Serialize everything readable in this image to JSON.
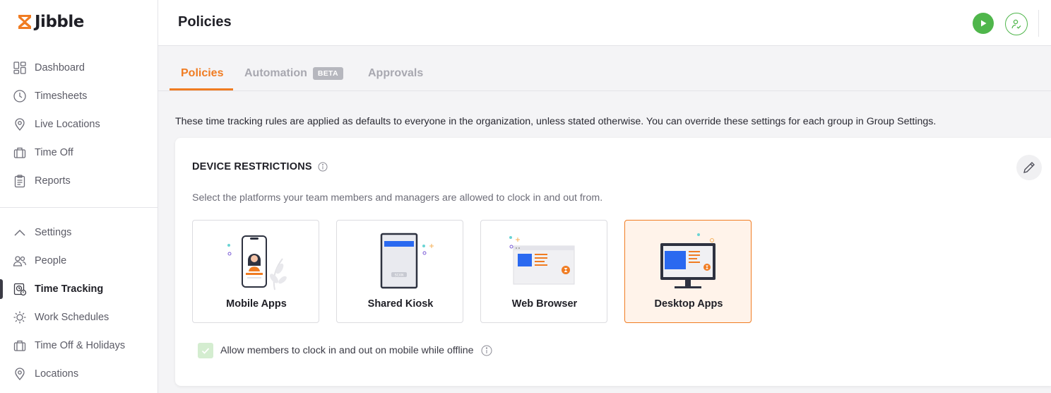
{
  "app": {
    "name": "Jibble",
    "brand_color": "#f07c22",
    "accent_green": "#4fb64b"
  },
  "sidebar": {
    "items": [
      {
        "label": "Dashboard",
        "icon": "dashboard-icon"
      },
      {
        "label": "Timesheets",
        "icon": "clock-icon"
      },
      {
        "label": "Live Locations",
        "icon": "location-pin-icon"
      },
      {
        "label": "Time Off",
        "icon": "suitcase-icon"
      },
      {
        "label": "Reports",
        "icon": "clipboard-icon"
      },
      {
        "label": "Settings",
        "icon": "chevron-up-icon"
      },
      {
        "label": "People",
        "icon": "people-icon"
      },
      {
        "label": "Time Tracking",
        "icon": "time-tracking-icon",
        "active": true
      },
      {
        "label": "Work Schedules",
        "icon": "work-schedule-icon"
      },
      {
        "label": "Time Off & Holidays",
        "icon": "suitcase-icon"
      },
      {
        "label": "Locations",
        "icon": "location-pin-icon"
      }
    ]
  },
  "header": {
    "title": "Policies"
  },
  "tabs": [
    {
      "label": "Policies",
      "active": true
    },
    {
      "label": "Automation",
      "badge": "BETA"
    },
    {
      "label": "Approvals"
    }
  ],
  "intro_text": "These time tracking rules are applied as defaults to everyone in the organization, unless stated otherwise. You can override these settings for each group in Group Settings.",
  "device_restrictions": {
    "title": "DEVICE RESTRICTIONS",
    "subtitle": "Select the platforms your team members and managers are allowed to clock in and out from.",
    "options": [
      {
        "label": "Mobile Apps",
        "selected": false
      },
      {
        "label": "Shared Kiosk",
        "selected": false,
        "scan_text": "SCAN"
      },
      {
        "label": "Web Browser",
        "selected": false
      },
      {
        "label": "Desktop Apps",
        "selected": true
      }
    ],
    "offline_checkbox": {
      "label": "Allow members to clock in and out on mobile while offline",
      "checked": true
    }
  }
}
